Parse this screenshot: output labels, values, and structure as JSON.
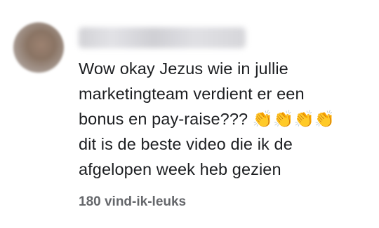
{
  "comment": {
    "author_name": "",
    "text_lines": [
      "Wow okay Jezus wie in jullie",
      "marketingteam verdient er een",
      "bonus en pay-raise??? 👏👏👏👏",
      "dit is de beste video die ik de",
      "afgelopen week heb gezien"
    ],
    "likes_label": "180 vind-ik-leuks"
  }
}
